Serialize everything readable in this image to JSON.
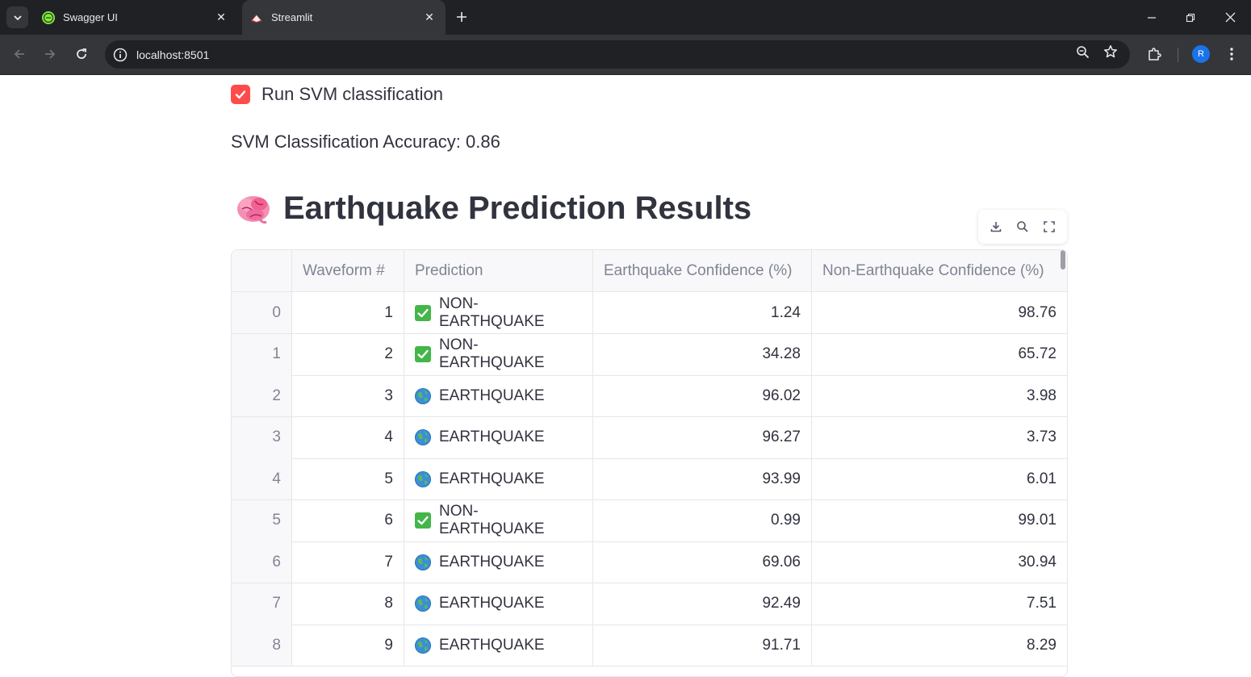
{
  "browser": {
    "tabs": [
      {
        "title": "Swagger UI",
        "favicon": "swagger-icon",
        "active": false
      },
      {
        "title": "Streamlit",
        "favicon": "streamlit-icon",
        "active": true
      }
    ],
    "url": "localhost:8501",
    "profile_initial": "R"
  },
  "app": {
    "checkbox_label": "Run SVM classification",
    "checkbox_checked": true,
    "accuracy_text": "SVM Classification Accuracy: 0.86",
    "heading": "Earthquake Prediction Results",
    "heading_icon": "brain-emoji",
    "accent_color": "#ff4b4b"
  },
  "table": {
    "columns": [
      "",
      "Waveform #",
      "Prediction",
      "Earthquake Confidence (%)",
      "Non-Earthquake Confidence (%)"
    ],
    "rows": [
      {
        "index": "0",
        "waveform": "1",
        "icon": "check-icon",
        "prediction": "NON-EARTHQUAKE",
        "eq": "1.24",
        "non_eq": "98.76"
      },
      {
        "index": "1",
        "waveform": "2",
        "icon": "check-icon",
        "prediction": "NON-EARTHQUAKE",
        "eq": "34.28",
        "non_eq": "65.72"
      },
      {
        "index": "2",
        "waveform": "3",
        "icon": "globe-icon",
        "prediction": "EARTHQUAKE",
        "eq": "96.02",
        "non_eq": "3.98"
      },
      {
        "index": "3",
        "waveform": "4",
        "icon": "globe-icon",
        "prediction": "EARTHQUAKE",
        "eq": "96.27",
        "non_eq": "3.73"
      },
      {
        "index": "4",
        "waveform": "5",
        "icon": "globe-icon",
        "prediction": "EARTHQUAKE",
        "eq": "93.99",
        "non_eq": "6.01"
      },
      {
        "index": "5",
        "waveform": "6",
        "icon": "check-icon",
        "prediction": "NON-EARTHQUAKE",
        "eq": "0.99",
        "non_eq": "99.01"
      },
      {
        "index": "6",
        "waveform": "7",
        "icon": "globe-icon",
        "prediction": "EARTHQUAKE",
        "eq": "69.06",
        "non_eq": "30.94"
      },
      {
        "index": "7",
        "waveform": "8",
        "icon": "globe-icon",
        "prediction": "EARTHQUAKE",
        "eq": "92.49",
        "non_eq": "7.51"
      },
      {
        "index": "8",
        "waveform": "9",
        "icon": "globe-icon",
        "prediction": "EARTHQUAKE",
        "eq": "91.71",
        "non_eq": "8.29"
      }
    ]
  }
}
